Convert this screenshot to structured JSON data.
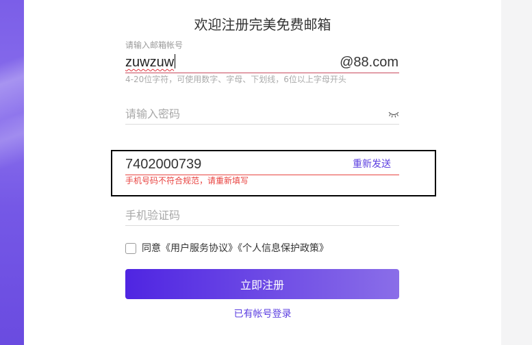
{
  "title": "欢迎注册完美免费邮箱",
  "email": {
    "label": "请输入邮箱帐号",
    "value": "zuwzuw",
    "suffix": "@88.com",
    "hint": "4-20位字符，可使用数字、字母、下划线，6位以上字母开头"
  },
  "password": {
    "placeholder": "请输入密码",
    "toggle_icon": "eye-closed-icon"
  },
  "phone": {
    "value": "7402000739",
    "resend_label": "重新发送",
    "error": "手机号码不符合规范，请重新填写"
  },
  "sms_code": {
    "placeholder": "手机验证码"
  },
  "agreement": {
    "checked": false,
    "text": "同意《用户服务协议》《个人信息保护政策》"
  },
  "submit_label": "立即注册",
  "login_link": "已有帐号登录",
  "colors": {
    "accent": "#5b3ee0",
    "error": "#e8423f",
    "button_gradient_start": "#4f25e2",
    "button_gradient_end": "#8a6ee8",
    "email_underline": "#c9485b"
  }
}
